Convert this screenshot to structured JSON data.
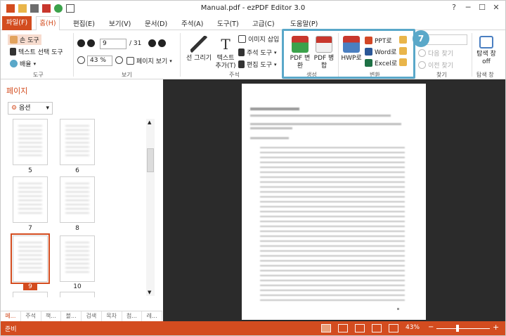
{
  "window": {
    "title": "Manual.pdf - ezPDF Editor 3.0"
  },
  "menu": [
    "파일(F)",
    "홈(H)",
    "편집(E)",
    "보기(V)",
    "문서(D)",
    "주석(A)",
    "도구(T)",
    "고급(C)",
    "도움말(P)"
  ],
  "ribbon": {
    "tools": {
      "hand": "손 도구",
      "text_select": "텍스트 선택 도구",
      "zoom": "배율",
      "label": "도구"
    },
    "view": {
      "page_value": "9",
      "page_total": "/ 31",
      "zoom_value": "43 %",
      "page_view": "페이지 보기",
      "label": "보기"
    },
    "annot": {
      "draw_line": "선 그리기",
      "add_text": "텍스트 추가(T)",
      "insert_image": "이미지 삽입",
      "annot_tool": "주석 도구",
      "edit_tool": "편집 도구",
      "label": "주석"
    },
    "create": {
      "pdf_convert": "PDF 변환",
      "pdf_merge": "PDF 병합",
      "label": "생성"
    },
    "convert": {
      "hwp": "HWP로",
      "ppt": "PPT로",
      "word": "Word로",
      "excel": "Excel로",
      "label": "변환"
    },
    "find": {
      "next": "다음 찾기",
      "prev": "이전 찾기",
      "label": "찾기"
    },
    "explorer": {
      "btn": "탐색 창 off",
      "label": "탐색 창"
    }
  },
  "callout": {
    "number": "7"
  },
  "left_pane": {
    "title": "페이지",
    "options": "옵션",
    "pages": [
      "5",
      "6",
      "7",
      "8",
      "9",
      "10"
    ],
    "selected_page": "9",
    "tabs": [
      "페...",
      "주석",
      "책...",
      "블...",
      "검색",
      "목차",
      "첨...",
      "레..."
    ]
  },
  "status": {
    "text": "준비",
    "zoom": "43%"
  },
  "colors": {
    "accent": "#d34c1f",
    "callout": "#5aa8c9",
    "doc_bg": "#2b2b2b"
  }
}
